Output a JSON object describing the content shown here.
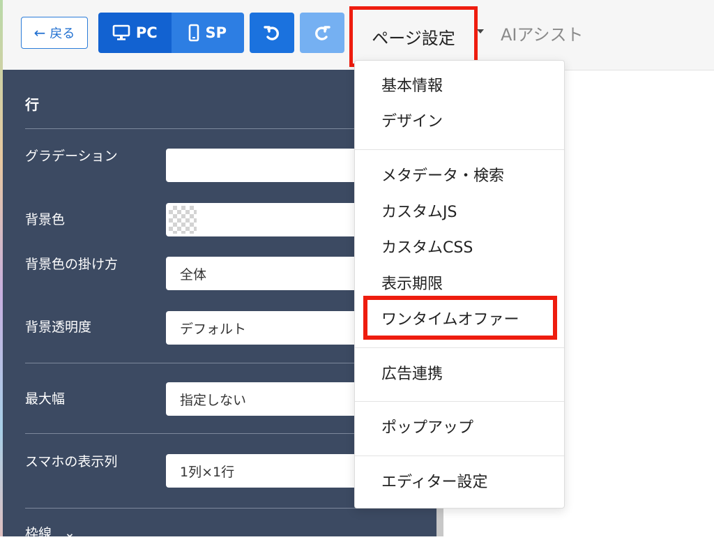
{
  "toolbar": {
    "back_label": "戻る",
    "pc_label": "PC",
    "sp_label": "SP",
    "page_settings_label": "ページ設定",
    "ai_assist_label": "AIアシスト"
  },
  "panel": {
    "section_title": "行",
    "rows": {
      "gradation_label": "グラデーション",
      "gradation_value": "",
      "bg_color_label": "背景色",
      "bg_apply_label": "背景色の掛け方",
      "bg_apply_value": "全体",
      "bg_opacity_label": "背景透明度",
      "bg_opacity_value": "デフォルト",
      "max_width_label": "最大幅",
      "max_width_value": "指定しない",
      "sp_columns_label": "スマホの表示列",
      "sp_columns_value": "1列×1行",
      "border_label": "枠線"
    }
  },
  "dropdown": {
    "items": [
      "基本情報",
      "デザイン",
      "メタデータ・検索",
      "カスタムJS",
      "カスタムCSS",
      "表示期限",
      "ワンタイムオファー",
      "広告連携",
      "ポップアップ",
      "エディター設定"
    ]
  },
  "colors": {
    "primary": "#1262d1",
    "highlight": "#ee1d0f",
    "panel_bg": "#3c4a62"
  },
  "icons": [
    "arrow-left-icon",
    "desktop-icon",
    "smartphone-icon",
    "undo-icon",
    "redo-icon",
    "caret-down-icon",
    "chevron-down-icon"
  ]
}
